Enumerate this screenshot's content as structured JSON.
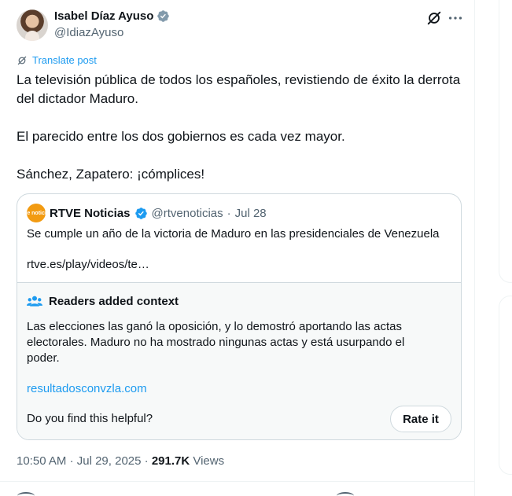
{
  "author": {
    "name": "Isabel Díaz Ayuso",
    "handle": "@IdiazAyuso"
  },
  "translate_label": "Translate post",
  "tweet_text": "La televisión pública de todos los españoles, revistiendo de éxito la derrota del dictador Maduro.\n\nEl parecido entre los dos gobiernos es cada vez mayor.\n\nSánchez, Zapatero: ¡cómplices!",
  "quote": {
    "avatar_text": "rtve noticias",
    "name": "RTVE Noticias",
    "handle": "@rtvenoticias",
    "separator": "·",
    "date": "Jul 28",
    "text": "Se cumple un año de la victoria de Maduro en las presidenciales de Venezuela",
    "link": "rtve.es/play/videos/te…"
  },
  "context": {
    "title": "Readers added context",
    "text": "Las elecciones las ganó la oposición, y lo demostró aportando las actas electorales. Maduro no ha mostrado ningunas actas y está usurpando el poder.",
    "link": "resultadosconvzla.com",
    "question": "Do you find this helpful?",
    "rate_label": "Rate it"
  },
  "meta": {
    "time": "10:50 AM",
    "separator": "·",
    "date": "Jul 29, 2025",
    "views_count": "291.7K",
    "views_label": "Views"
  },
  "colors": {
    "accent": "#1d9bf0",
    "text": "#0f1419",
    "muted": "#536471",
    "border": "#cfd9de",
    "context_bg": "#f7f9f9",
    "rtve_orange": "#f29b12"
  },
  "icons": [
    "verified-badge-icon",
    "grok-icon",
    "more-icon",
    "translate-icon",
    "community-notes-icon"
  ]
}
